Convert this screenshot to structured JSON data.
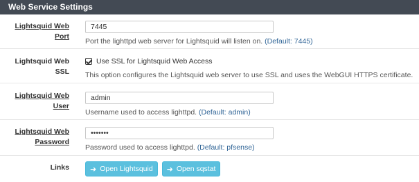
{
  "panel": {
    "title": "Web Service Settings"
  },
  "rows": {
    "port": {
      "label": "Lightsquid Web Port",
      "value": "7445",
      "help": "Port the lighttpd web server for Lightsquid will listen on.",
      "default": "(Default: 7445)"
    },
    "ssl": {
      "label": "Lightsquid Web SSL",
      "checkbox_label": "Use SSL for Lightsquid Web Access",
      "checked": true,
      "help": "This option configures the Lightsquid web server to use SSL and uses the WebGUI HTTPS certificate."
    },
    "user": {
      "label_line1": "Lightsquid Web",
      "label_line2": "User",
      "value": "admin",
      "help": "Username used to access lighttpd.",
      "default": "(Default: admin)"
    },
    "password": {
      "label_line1": "Lightsquid Web",
      "label_line2": "Password",
      "value": "•••••••",
      "help": "Password used to access lighttpd.",
      "default": "(Default: pfsense)"
    },
    "links": {
      "label": "Links",
      "buttons": [
        {
          "label": "Open Lightsquid",
          "icon": "sign-in-icon"
        },
        {
          "label": "Open sqstat",
          "icon": "sign-in-icon"
        }
      ]
    }
  },
  "colors": {
    "heading_bg": "#434a54",
    "button_bg": "#5bc0de",
    "default_text": "#2f6496"
  }
}
